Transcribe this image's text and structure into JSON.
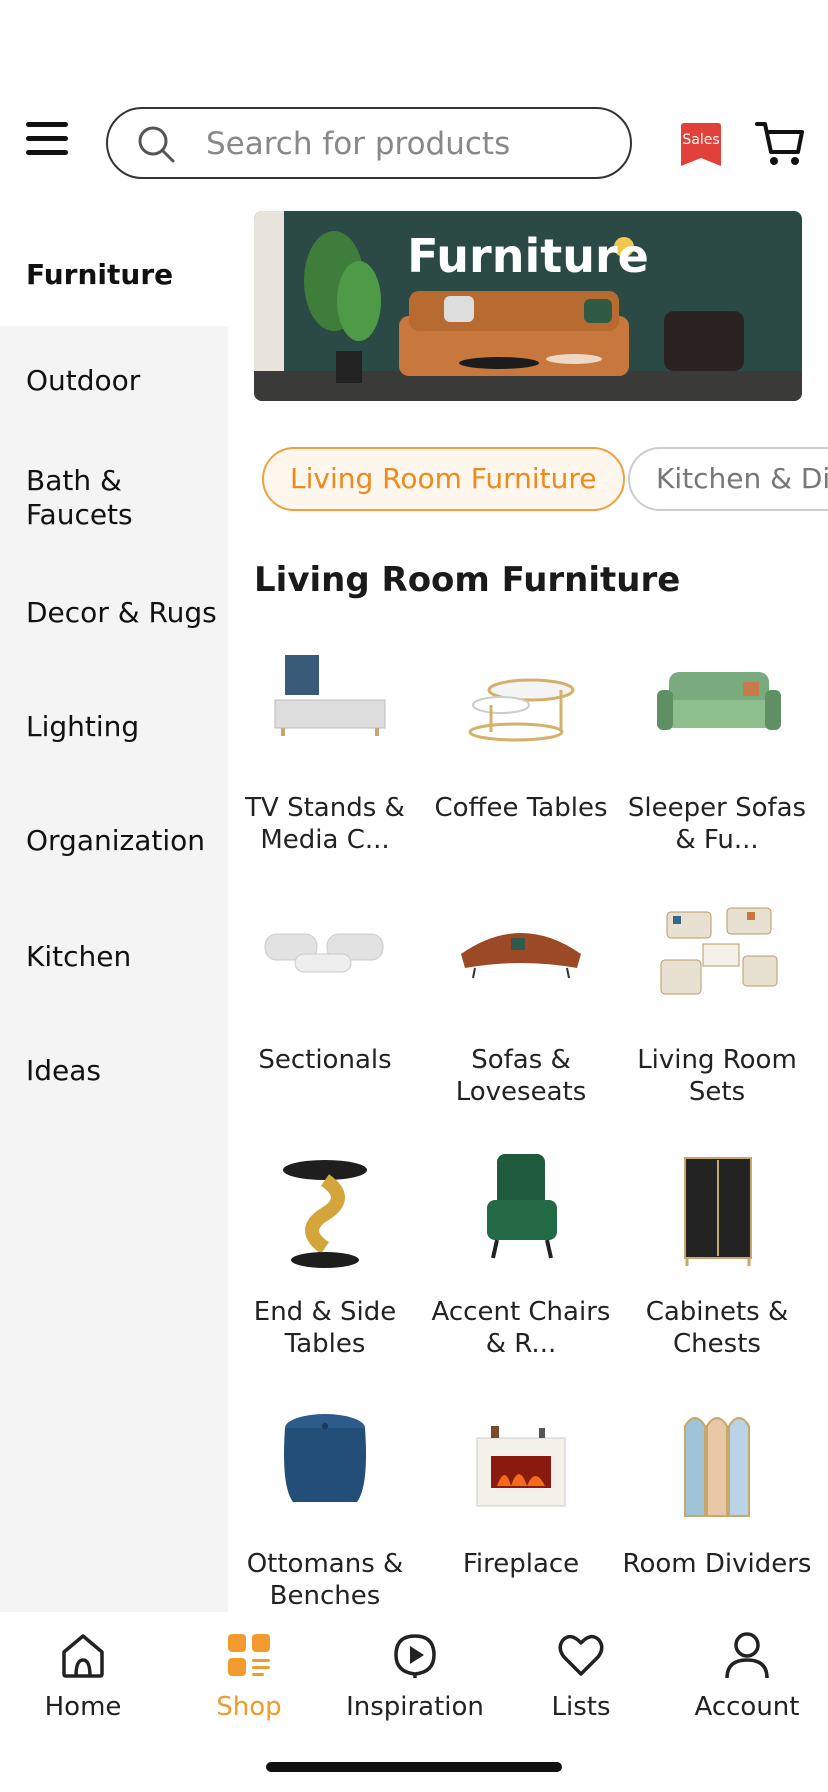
{
  "header": {
    "search_placeholder": "Search for products",
    "sales_badge": "Sales"
  },
  "sidebar": {
    "items": [
      {
        "label": "Furniture",
        "active": true
      },
      {
        "label": "Outdoor",
        "active": false
      },
      {
        "label": "Bath & Faucets",
        "active": false
      },
      {
        "label": "Decor & Rugs",
        "active": false
      },
      {
        "label": "Lighting",
        "active": false
      },
      {
        "label": "Organization",
        "active": false
      },
      {
        "label": "Kitchen",
        "active": false
      },
      {
        "label": "Ideas",
        "active": false
      }
    ]
  },
  "banner": {
    "title": "Furniture"
  },
  "chips": [
    {
      "label": "Living Room Furniture",
      "active": true
    },
    {
      "label": "Kitchen & Di",
      "active": false
    }
  ],
  "section": {
    "title": "Living Room Furniture"
  },
  "products": [
    {
      "label": "TV Stands & Media C...",
      "icon": "tv-stand-icon"
    },
    {
      "label": "Coffee Tables",
      "icon": "coffee-table-icon"
    },
    {
      "label": "Sleeper Sofas & Fu...",
      "icon": "sleeper-sofa-icon"
    },
    {
      "label": "Sectionals",
      "icon": "sectional-icon"
    },
    {
      "label": "Sofas & Loveseats",
      "icon": "sofa-icon"
    },
    {
      "label": "Living Room Sets",
      "icon": "living-room-set-icon"
    },
    {
      "label": "End & Side Tables",
      "icon": "side-table-icon"
    },
    {
      "label": "Accent Chairs & R...",
      "icon": "accent-chair-icon"
    },
    {
      "label": "Cabinets & Chests",
      "icon": "cabinet-icon"
    },
    {
      "label": "Ottomans & Benches",
      "icon": "ottoman-icon"
    },
    {
      "label": "Fireplace",
      "icon": "fireplace-icon"
    },
    {
      "label": "Room Dividers",
      "icon": "room-divider-icon"
    }
  ],
  "bottom_nav": [
    {
      "label": "Home",
      "icon": "home-icon",
      "active": false
    },
    {
      "label": "Shop",
      "icon": "shop-icon",
      "active": true
    },
    {
      "label": "Inspiration",
      "icon": "inspiration-icon",
      "active": false
    },
    {
      "label": "Lists",
      "icon": "heart-icon",
      "active": false
    },
    {
      "label": "Account",
      "icon": "account-icon",
      "active": false
    }
  ],
  "colors": {
    "accent": "#f29a2e",
    "sidebar_bg": "#f4f4f4",
    "banner_bg": "#2c4a45"
  }
}
